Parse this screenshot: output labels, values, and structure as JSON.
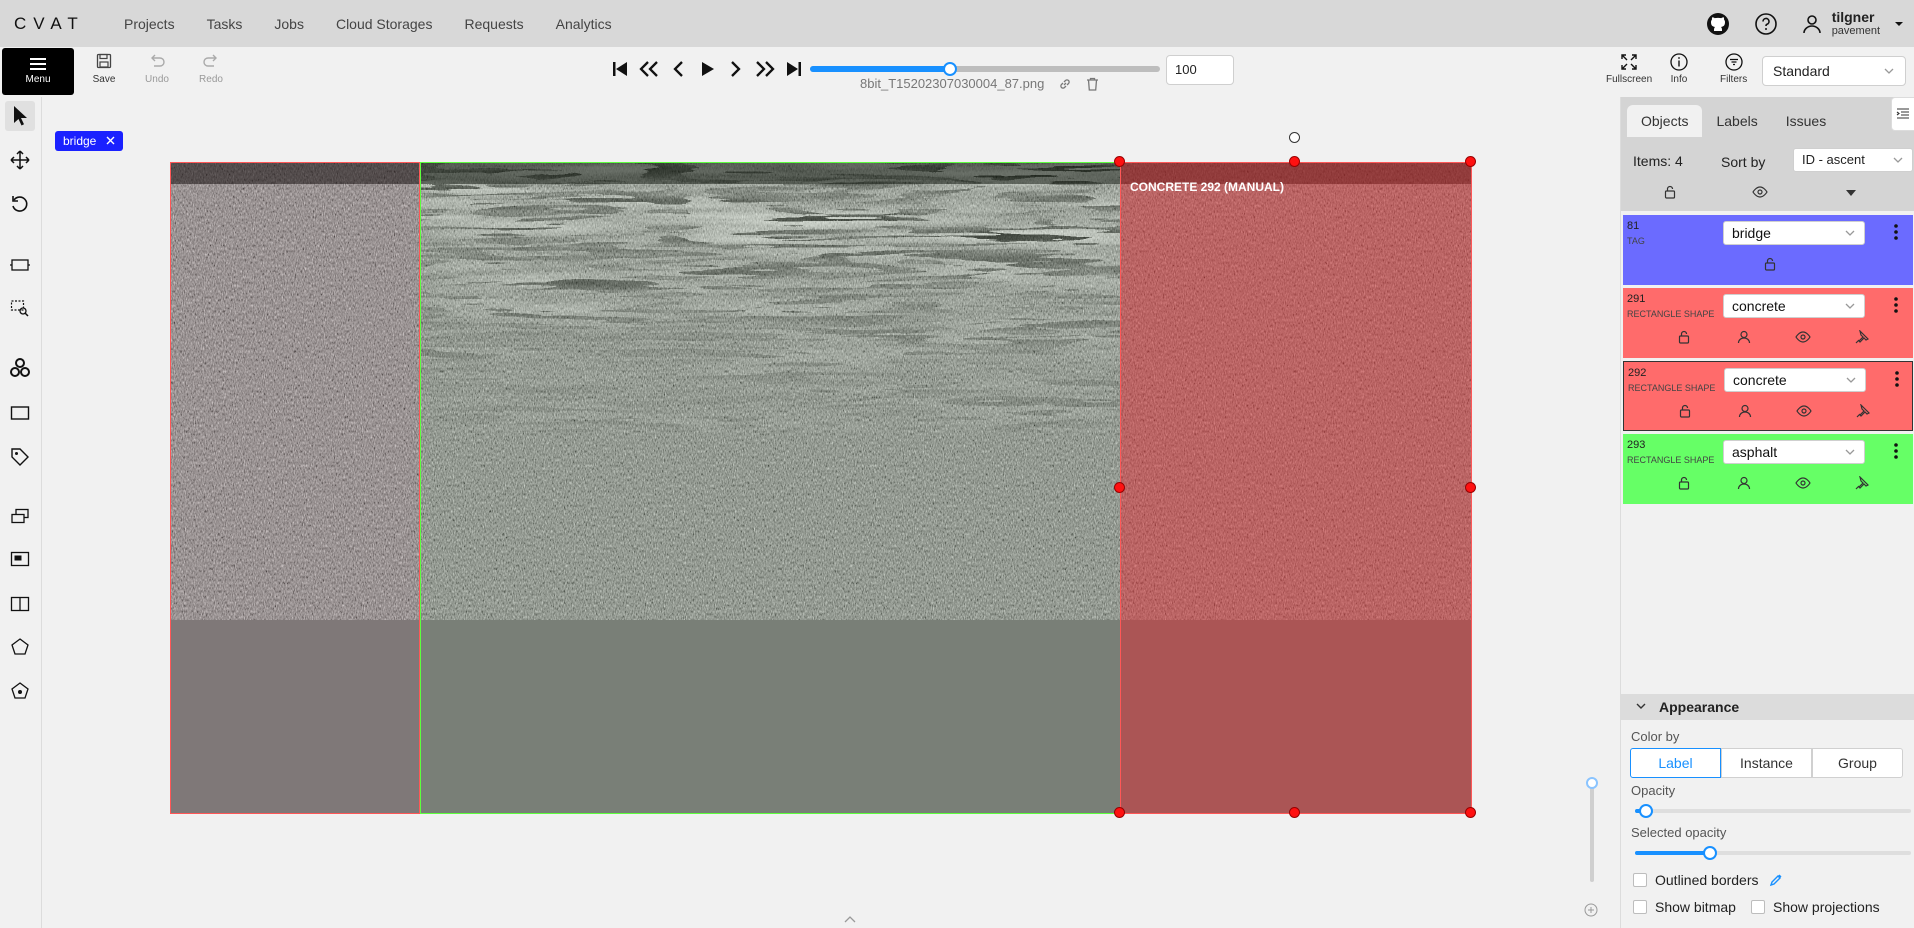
{
  "app": {
    "logo": "CVAT"
  },
  "nav": {
    "links": [
      "Projects",
      "Tasks",
      "Jobs",
      "Cloud Storages",
      "Requests",
      "Analytics"
    ],
    "user": {
      "name": "tilgner",
      "org": "pavement"
    }
  },
  "toolbar": {
    "menu_label": "Menu",
    "save_label": "Save",
    "undo_label": "Undo",
    "redo_label": "Redo",
    "frame_value": "100",
    "frame_progress": 0.4,
    "filename": "8bit_T15202307030004_87.png",
    "fullscreen_label": "Fullscreen",
    "info_label": "Info",
    "filters_label": "Filters",
    "workspace": "Standard"
  },
  "canvas": {
    "tag_chip": "bridge",
    "selected_label": "CONCRETE 292 (MANUAL)",
    "colors": {
      "concrete": "#ff5757",
      "asphalt": "#5cff3d",
      "bridge": "#1a21ff"
    }
  },
  "sidebar": {
    "tabs": [
      "Objects",
      "Labels",
      "Issues"
    ],
    "items_count": "Items: 4",
    "sort_by_label": "Sort by",
    "sort_value": "ID - ascent",
    "objects": [
      {
        "id": "81",
        "type": "TAG",
        "label": "bridge",
        "color": "#6b6bff"
      },
      {
        "id": "291",
        "type": "RECTANGLE SHAPE",
        "label": "concrete",
        "color": "#ff6b6b"
      },
      {
        "id": "292",
        "type": "RECTANGLE SHAPE",
        "label": "concrete",
        "color": "#ff6b6b"
      },
      {
        "id": "293",
        "type": "RECTANGLE SHAPE",
        "label": "asphalt",
        "color": "#66ff66"
      }
    ],
    "appearance": {
      "title": "Appearance",
      "color_by_label": "Color by",
      "color_by_options": [
        "Label",
        "Instance",
        "Group"
      ],
      "color_by_selected": "Label",
      "opacity_label": "Opacity",
      "opacity_value": 0.04,
      "selected_opacity_label": "Selected opacity",
      "selected_opacity_value": 0.27,
      "outlined_borders_label": "Outlined borders",
      "show_bitmap_label": "Show bitmap",
      "show_projections_label": "Show projections"
    }
  }
}
